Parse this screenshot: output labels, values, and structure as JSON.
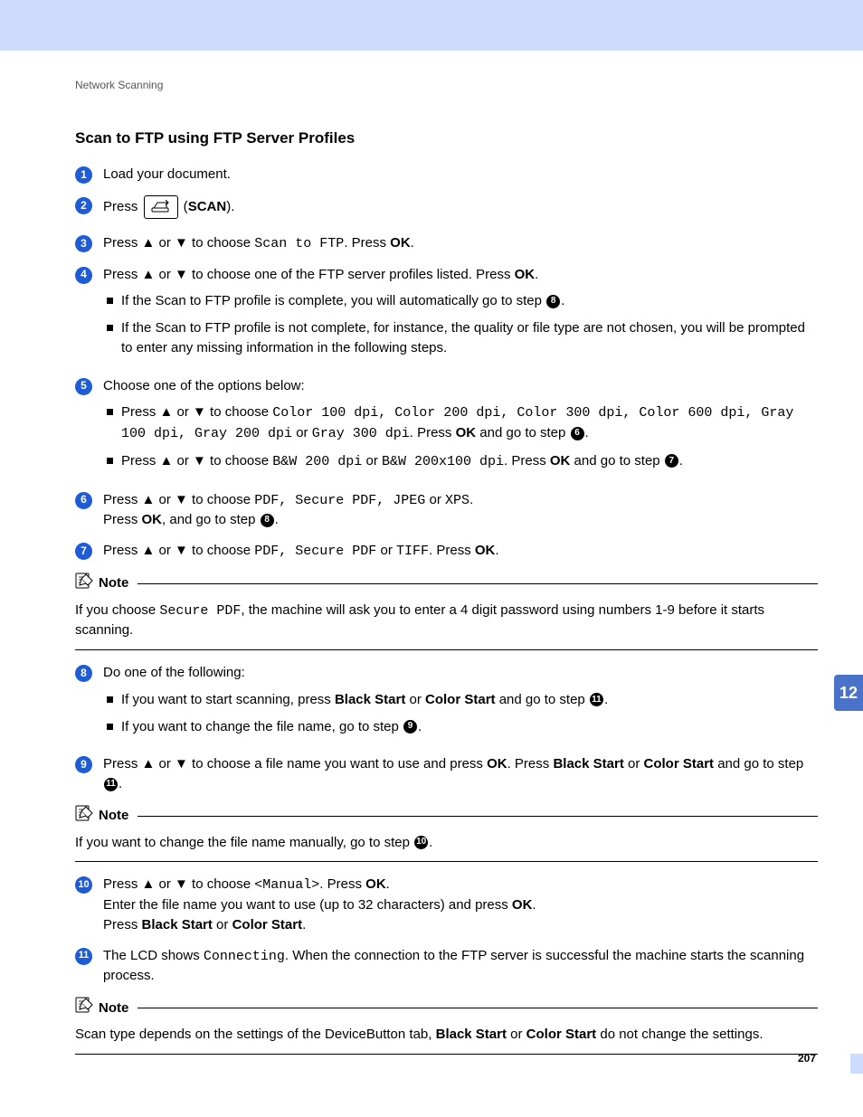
{
  "chapter_tab": "12",
  "page_number": "207",
  "section_label": "Network Scanning",
  "section_title": "Scan to FTP using FTP Server Profiles",
  "scan_label": "SCAN",
  "note_label": "Note",
  "steps": {
    "s1": {
      "text": "Load your document."
    },
    "s2": {
      "prefix": "Press ",
      "suffix_open": " (",
      "scan": "SCAN",
      "suffix_close": ")."
    },
    "s3": {
      "p1": "Press ",
      "arrows": "▲ or ▼",
      "p2": " to choose ",
      "code": "Scan to FTP",
      "p3": ". Press ",
      "ok": "OK",
      "p4": "."
    },
    "s4": {
      "p1": "Press ",
      "arrows": "▲ or ▼",
      "p2": " to choose one of the FTP server profiles listed. Press ",
      "ok": "OK",
      "p3": ".",
      "b1": {
        "text": "If the Scan to FTP profile is complete, you will automatically go to step ",
        "ref": "8",
        "suffix": "."
      },
      "b2": {
        "text": "If the Scan to FTP profile is not complete, for instance, the quality or file type are not chosen, you will be prompted to enter any missing information in the following steps."
      }
    },
    "s5": {
      "intro": "Choose one of the options below:",
      "b1": {
        "p1": "Press ",
        "arrows": "▲ or ▼",
        "p2": " to choose ",
        "opts": "Color 100 dpi, Color 200 dpi, Color 300 dpi, Color 600 dpi, Gray 100 dpi, Gray 200 dpi",
        "p3": " or ",
        "opt_last": "Gray 300 dpi",
        "p4": ". Press ",
        "ok": "OK",
        "p5": " and go to step ",
        "ref": "6",
        "p6": "."
      },
      "b2": {
        "p1": "Press ",
        "arrows": "▲ or ▼",
        "p2": " to choose ",
        "opt1": "B&W 200 dpi",
        "p3": " or ",
        "opt2": "B&W 200x100 dpi",
        "p4": ". Press ",
        "ok": "OK",
        "p5": " and go to step ",
        "ref": "7",
        "p6": "."
      }
    },
    "s6": {
      "p1": "Press ",
      "arrows": "▲ or ▼",
      "p2": " to choose ",
      "opts": "PDF, Secure PDF, JPEG",
      "p3": " or ",
      "opt_last": "XPS",
      "p4": ".",
      "line2a": "Press ",
      "ok": "OK",
      "line2b": ", and go to step ",
      "ref": "8",
      "line2c": "."
    },
    "s7": {
      "p1": "Press ",
      "arrows": "▲ or ▼",
      "p2": " to choose ",
      "opts": "PDF, Secure PDF",
      "p3": " or ",
      "opt_last": "TIFF",
      "p4": ". Press ",
      "ok": "OK",
      "p5": "."
    },
    "s8": {
      "intro": "Do one of the following:",
      "b1": {
        "p1": "If you want to start scanning, press ",
        "b1a": "Black Start",
        "p2": " or ",
        "b1b": "Color Start",
        "p3": " and go to step ",
        "ref": "11",
        "p4": "."
      },
      "b2": {
        "p1": "If you want to change the file name, go to step ",
        "ref": "9",
        "p2": "."
      }
    },
    "s9": {
      "p1": "Press ",
      "arrows": "▲ or ▼",
      "p2": " to choose a file name you want to use and press ",
      "ok1": "OK",
      "p3": ". Press ",
      "b1": "Black Start",
      "p4": " or ",
      "b2": "Color Start",
      "p5": " and go to step ",
      "ref": "11",
      "p6": "."
    },
    "s10": {
      "l1p1": "Press ",
      "arrows": "▲ or ▼",
      "l1p2": " to choose ",
      "code": "<Manual>",
      "l1p3": ". Press ",
      "ok": "OK",
      "l1p4": ".",
      "l2p1": "Enter the file name you want to use (up to 32 characters) and press ",
      "ok2": "OK",
      "l2p2": ".",
      "l3p1": "Press ",
      "b1": "Black Start",
      "l3p2": " or ",
      "b2": "Color Start",
      "l3p3": "."
    },
    "s11": {
      "p1": "The LCD shows ",
      "code": "Connecting",
      "p2": ". When the connection to the FTP server is successful the machine starts the scanning process."
    }
  },
  "notes": {
    "n1": {
      "p1": "If you choose ",
      "code": "Secure PDF",
      "p2": ", the machine will ask you to enter a 4 digit password using numbers 1-9 before it starts scanning."
    },
    "n2": {
      "p1": "If you want to change the file name manually, go to step ",
      "ref": "10",
      "p2": "."
    },
    "n3": {
      "p1": "Scan type depends on the settings of the DeviceButton tab, ",
      "b1": "Black Start",
      "p2": " or ",
      "b2": "Color Start",
      "p3": " do not change the settings."
    }
  }
}
